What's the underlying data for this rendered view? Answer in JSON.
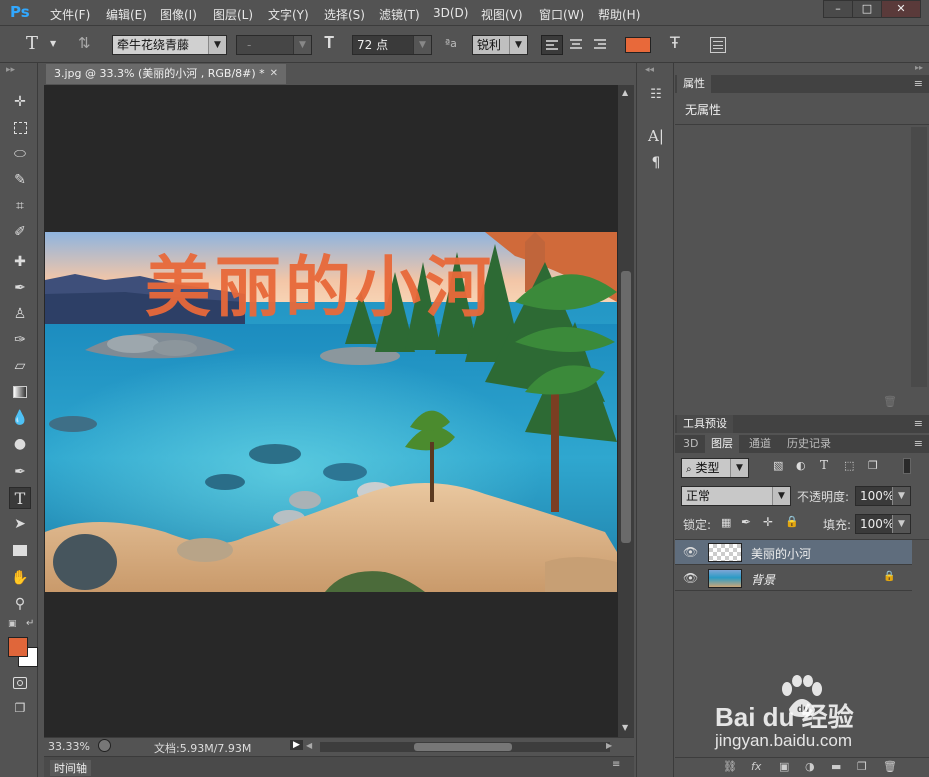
{
  "menu": {
    "logo": "Ps",
    "items": [
      "文件(F)",
      "编辑(E)",
      "图像(I)",
      "图层(L)",
      "文字(Y)",
      "选择(S)",
      "滤镜(T)",
      "3D(D)",
      "视图(V)",
      "窗口(W)",
      "帮助(H)"
    ]
  },
  "options": {
    "font_family": "牵牛花绕青藤",
    "font_style": "-",
    "font_size": "72 点",
    "antialias": "锐利",
    "text_color": "#e8693a"
  },
  "document": {
    "tab_title": "3.jpg @ 33.3% (美丽的小河 , RGB/8#) *",
    "canvas_text": "美丽的小河",
    "text_color": "#e8693a"
  },
  "status": {
    "zoom": "33.33%",
    "doc_info": "文档:5.93M/7.93M"
  },
  "timeline": {
    "label": "时间轴"
  },
  "properties": {
    "tab": "属性",
    "body_text": "无属性"
  },
  "tool_presets": {
    "tab": "工具预设"
  },
  "layers_panel": {
    "tabs": [
      "3D",
      "图层",
      "通道",
      "历史记录"
    ],
    "filter_type": "类型",
    "blend_mode": "正常",
    "opacity_label": "不透明度:",
    "opacity_value": "100%",
    "lock_label": "锁定:",
    "fill_label": "填充:",
    "fill_value": "100%",
    "layers": [
      {
        "name": "美丽的小河",
        "type": "text",
        "selected": true
      },
      {
        "name": "背景",
        "type": "image",
        "locked": true
      }
    ]
  },
  "watermark": {
    "brand": "Bai du 经验",
    "url": "jingyan.baidu.com"
  },
  "colors": {
    "foreground": "#e0663a",
    "background": "#ffffff",
    "accent": "#31a8ff"
  }
}
